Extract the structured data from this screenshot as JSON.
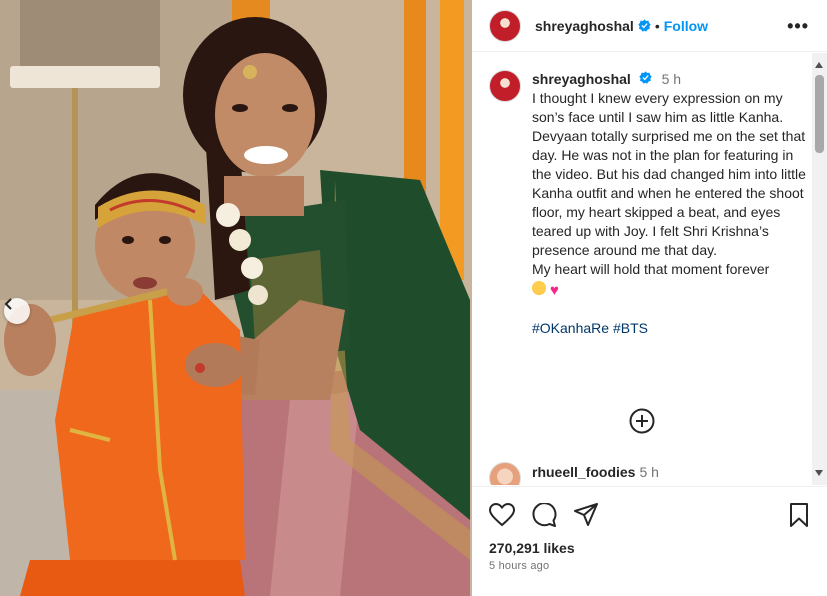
{
  "post": {
    "username": "shreyaghoshal",
    "follow_label": "Follow",
    "separator": "•",
    "more_label": "•••"
  },
  "caption": {
    "username": "shreyaghoshal",
    "time": "5 h",
    "text": "I thought I knew every expression on my son’s face until I saw him as little Kanha.\nDevyaan totally surprised me on the set that day. He was not in the plan for featuring in the video. But his dad changed him into little Kanha outfit and when he entered the shoot floor, my heart skipped a beat, and eyes teared up with Joy. I felt Shri Krishna’s presence around me that day.\nMy heart will hold that moment forever",
    "hashtags": [
      "#OKanhaRe",
      "#BTS"
    ]
  },
  "comments": [
    {
      "username": "rhueell_foodies",
      "time": "5 h"
    }
  ],
  "footer": {
    "likes": "270,291 likes",
    "posted": "5 hours ago"
  },
  "icons": {
    "like": "heart-icon",
    "comment": "comment-icon",
    "share": "paper-plane-icon",
    "save": "bookmark-icon",
    "load_more": "plus-circle-icon",
    "verified": "verified-badge-icon",
    "carousel_prev": "chevron-left-icon"
  },
  "colors": {
    "follow": "#0095f6",
    "hashtag": "#00376b",
    "verified": "#0095f6",
    "secondary_text": "#737373"
  }
}
